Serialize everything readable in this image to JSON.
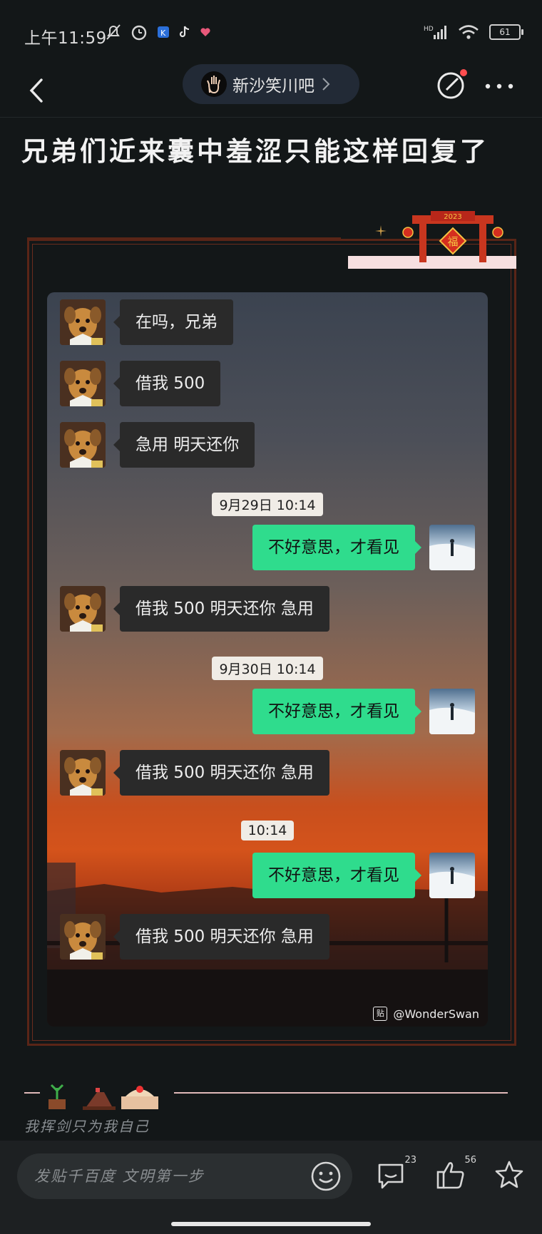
{
  "status_bar": {
    "time": "上午11:59",
    "network": "HD",
    "battery": "61"
  },
  "header": {
    "forum_name": "新沙笑川吧"
  },
  "post": {
    "title": "兄弟们近来囊中羞涩只能这样回复了"
  },
  "chat": {
    "messages": [
      {
        "side": "left",
        "text": "在吗，兄弟"
      },
      {
        "side": "left",
        "text": "借我 500"
      },
      {
        "side": "left",
        "text": "急用 明天还你"
      },
      {
        "time": "9月29日 10:14"
      },
      {
        "side": "right",
        "text": "不好意思，才看见"
      },
      {
        "side": "left",
        "text": "借我 500 明天还你 急用"
      },
      {
        "time": "9月30日 10:14"
      },
      {
        "side": "right",
        "text": "不好意思，才看见"
      },
      {
        "side": "left",
        "text": "借我 500 明天还你 急用"
      },
      {
        "time": "10:14"
      },
      {
        "side": "right",
        "text": "不好意思，才看见"
      },
      {
        "side": "left",
        "text": "借我 500 明天还你 急用"
      }
    ],
    "watermark": "@WonderSwan",
    "watermark_logo": "贴"
  },
  "decoration": {
    "banner_year": "2023",
    "banner_char": "福"
  },
  "signature": {
    "text": "我挥剑只为我自己"
  },
  "bottom_bar": {
    "comment_placeholder": "发贴千百度 文明第一步",
    "comment_count": "23",
    "like_count": "56"
  },
  "colors": {
    "background": "#131718",
    "bubble_green": "#2fdc8d",
    "bubble_dark": "#2a2a2a",
    "frame": "#5a2517"
  }
}
